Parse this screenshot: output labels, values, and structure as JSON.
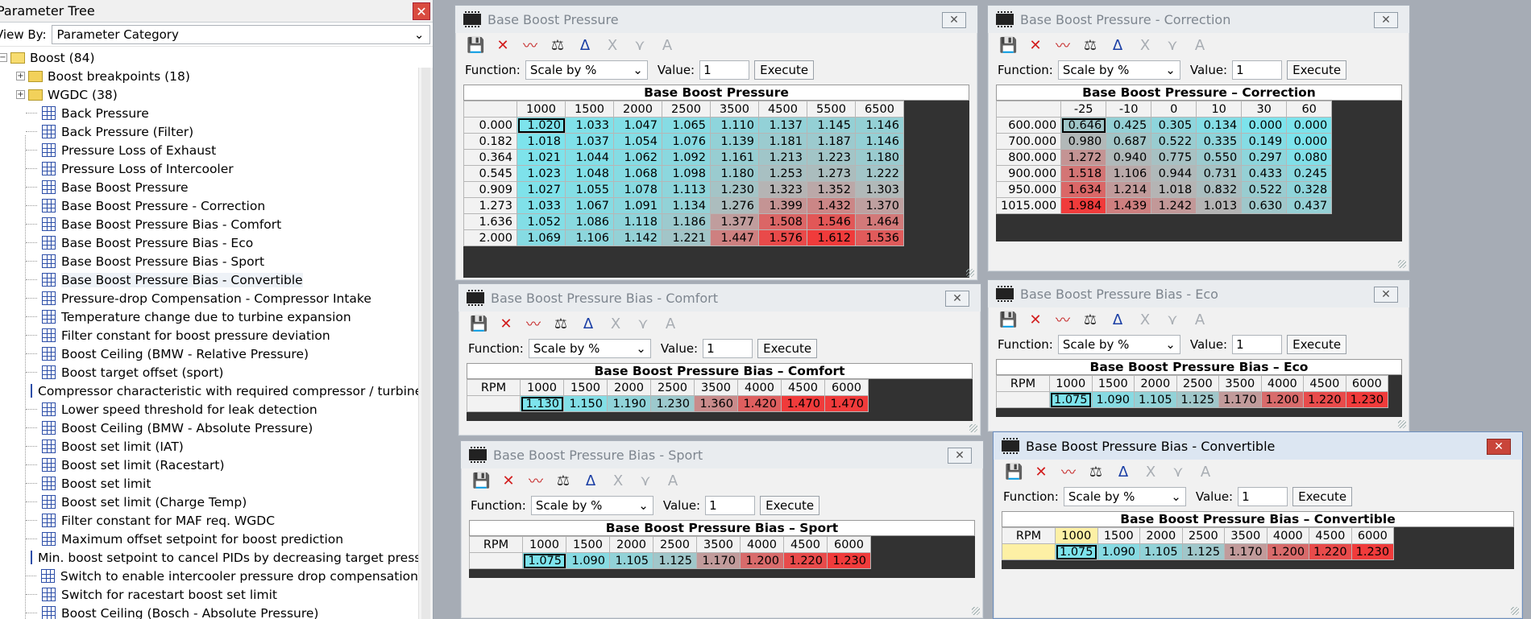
{
  "tree": {
    "title": "Parameter Tree",
    "close_glyph": "✕",
    "view_by_label": "View By:",
    "view_by_value": "Parameter Category",
    "root": {
      "label": "Boost (84)",
      "expander": "−"
    },
    "folders": [
      {
        "label": "Boost breakpoints (18)",
        "expander": "+"
      },
      {
        "label": "WGDC (38)",
        "expander": "+"
      }
    ],
    "items": [
      "Back Pressure",
      "Back Pressure (Filter)",
      "Pressure Loss of Exhaust",
      "Pressure Loss of Intercooler",
      "Base Boost Pressure",
      "Base Boost Pressure - Correction",
      "Base Boost Pressure Bias - Comfort",
      "Base Boost Pressure Bias - Eco",
      "Base Boost Pressure Bias - Sport",
      "Base Boost Pressure Bias - Convertible",
      "Pressure-drop Compensation - Compressor Intake",
      "Temperature change due to turbine expansion",
      "Filter constant for boost pressure deviation",
      "Boost Ceiling (BMW - Relative Pressure)",
      "Boost target offset (sport)",
      "Compressor characteristic with required compressor / turbine po",
      "Lower speed threshold for leak detection",
      "Boost Ceiling (BMW - Absolute Pressure)",
      "Boost set limit (IAT)",
      "Boost set limit (Racestart)",
      "Boost set limit",
      "Boost set limit (Charge Temp)",
      "Filter constant for MAF req. WGDC",
      "Maximum offset setpoint for boost prediction",
      "Min. boost setpoint to cancel PIDs by decreasing target pressure",
      "Switch to enable intercooler pressure drop compensation",
      "Switch for racestart boost set limit",
      "Boost Ceiling (Bosch - Absolute Pressure)"
    ]
  },
  "common": {
    "function_label": "Function:",
    "function_value": "Scale by %",
    "value_label": "Value:",
    "value_value": "1",
    "execute_label": "Execute",
    "close_glyph": "✕",
    "rpm_label": "RPM",
    "icons": {
      "save": "💾",
      "delete": "✕",
      "graph": "〰",
      "scale": "⚖",
      "ruler": "Δ",
      "cut": "Ⅹ",
      "split": "⋎",
      "text": "A"
    }
  },
  "colors": {
    "low": "#7de3ec",
    "mid": "#b3b7b7",
    "high": "#f03b3b",
    "selected_header": "#fdf0a5"
  },
  "windows": {
    "base": {
      "title": "Base Boost Pressure",
      "grid_title": "Base Boost Pressure",
      "columns": [
        "1000",
        "1500",
        "2000",
        "2500",
        "3500",
        "4500",
        "5500",
        "6500"
      ],
      "rows": [
        {
          "label": "0.000",
          "values": [
            "1.020",
            "1.033",
            "1.047",
            "1.065",
            "1.110",
            "1.137",
            "1.145",
            "1.146"
          ]
        },
        {
          "label": "0.182",
          "values": [
            "1.018",
            "1.037",
            "1.054",
            "1.076",
            "1.139",
            "1.181",
            "1.187",
            "1.146"
          ]
        },
        {
          "label": "0.364",
          "values": [
            "1.021",
            "1.044",
            "1.062",
            "1.092",
            "1.161",
            "1.213",
            "1.223",
            "1.180"
          ]
        },
        {
          "label": "0.545",
          "values": [
            "1.023",
            "1.048",
            "1.068",
            "1.098",
            "1.180",
            "1.253",
            "1.273",
            "1.222"
          ]
        },
        {
          "label": "0.909",
          "values": [
            "1.027",
            "1.055",
            "1.078",
            "1.113",
            "1.230",
            "1.323",
            "1.352",
            "1.303"
          ]
        },
        {
          "label": "1.273",
          "values": [
            "1.033",
            "1.067",
            "1.091",
            "1.134",
            "1.276",
            "1.399",
            "1.432",
            "1.370"
          ]
        },
        {
          "label": "1.636",
          "values": [
            "1.052",
            "1.086",
            "1.118",
            "1.186",
            "1.377",
            "1.508",
            "1.546",
            "1.464"
          ]
        },
        {
          "label": "2.000",
          "values": [
            "1.069",
            "1.106",
            "1.142",
            "1.221",
            "1.447",
            "1.576",
            "1.612",
            "1.536"
          ]
        }
      ]
    },
    "correction": {
      "title": "Base Boost Pressure - Correction",
      "grid_title": "Base Boost Pressure – Correction",
      "columns": [
        "-25",
        "-10",
        "0",
        "10",
        "30",
        "60"
      ],
      "rows": [
        {
          "label": "600.000",
          "values": [
            "0.646",
            "0.425",
            "0.305",
            "0.134",
            "0.000",
            "0.000"
          ]
        },
        {
          "label": "700.000",
          "values": [
            "0.980",
            "0.687",
            "0.522",
            "0.335",
            "0.149",
            "0.000"
          ]
        },
        {
          "label": "800.000",
          "values": [
            "1.272",
            "0.940",
            "0.775",
            "0.550",
            "0.297",
            "0.080"
          ]
        },
        {
          "label": "900.000",
          "values": [
            "1.518",
            "1.106",
            "0.944",
            "0.731",
            "0.433",
            "0.245"
          ]
        },
        {
          "label": "950.000",
          "values": [
            "1.634",
            "1.214",
            "1.018",
            "0.832",
            "0.522",
            "0.328"
          ]
        },
        {
          "label": "1015.000",
          "values": [
            "1.984",
            "1.439",
            "1.242",
            "1.013",
            "0.630",
            "0.437"
          ]
        }
      ]
    },
    "comfort": {
      "title": "Base Boost Pressure Bias - Comfort",
      "grid_title": "Base Boost Pressure Bias – Comfort",
      "columns": [
        "1000",
        "1500",
        "2000",
        "2500",
        "3500",
        "4000",
        "4500",
        "6000"
      ],
      "values": [
        "1.130",
        "1.150",
        "1.190",
        "1.230",
        "1.360",
        "1.420",
        "1.470",
        "1.470"
      ]
    },
    "eco": {
      "title": "Base Boost Pressure Bias - Eco",
      "grid_title": "Base Boost Pressure Bias – Eco",
      "columns": [
        "1000",
        "1500",
        "2000",
        "2500",
        "3500",
        "4000",
        "4500",
        "6000"
      ],
      "values": [
        "1.075",
        "1.090",
        "1.105",
        "1.125",
        "1.170",
        "1.200",
        "1.220",
        "1.230"
      ]
    },
    "sport": {
      "title": "Base Boost Pressure Bias - Sport",
      "grid_title": "Base Boost Pressure Bias – Sport",
      "columns": [
        "1000",
        "1500",
        "2000",
        "2500",
        "3500",
        "4000",
        "4500",
        "6000"
      ],
      "values": [
        "1.075",
        "1.090",
        "1.105",
        "1.125",
        "1.170",
        "1.200",
        "1.220",
        "1.230"
      ]
    },
    "convertible": {
      "title": "Base Boost Pressure Bias - Convertible",
      "grid_title": "Base Boost Pressure Bias – Convertible",
      "columns": [
        "1000",
        "1500",
        "2000",
        "2500",
        "3500",
        "4000",
        "4500",
        "6000"
      ],
      "values": [
        "1.075",
        "1.090",
        "1.105",
        "1.125",
        "1.170",
        "1.200",
        "1.220",
        "1.230"
      ]
    }
  }
}
